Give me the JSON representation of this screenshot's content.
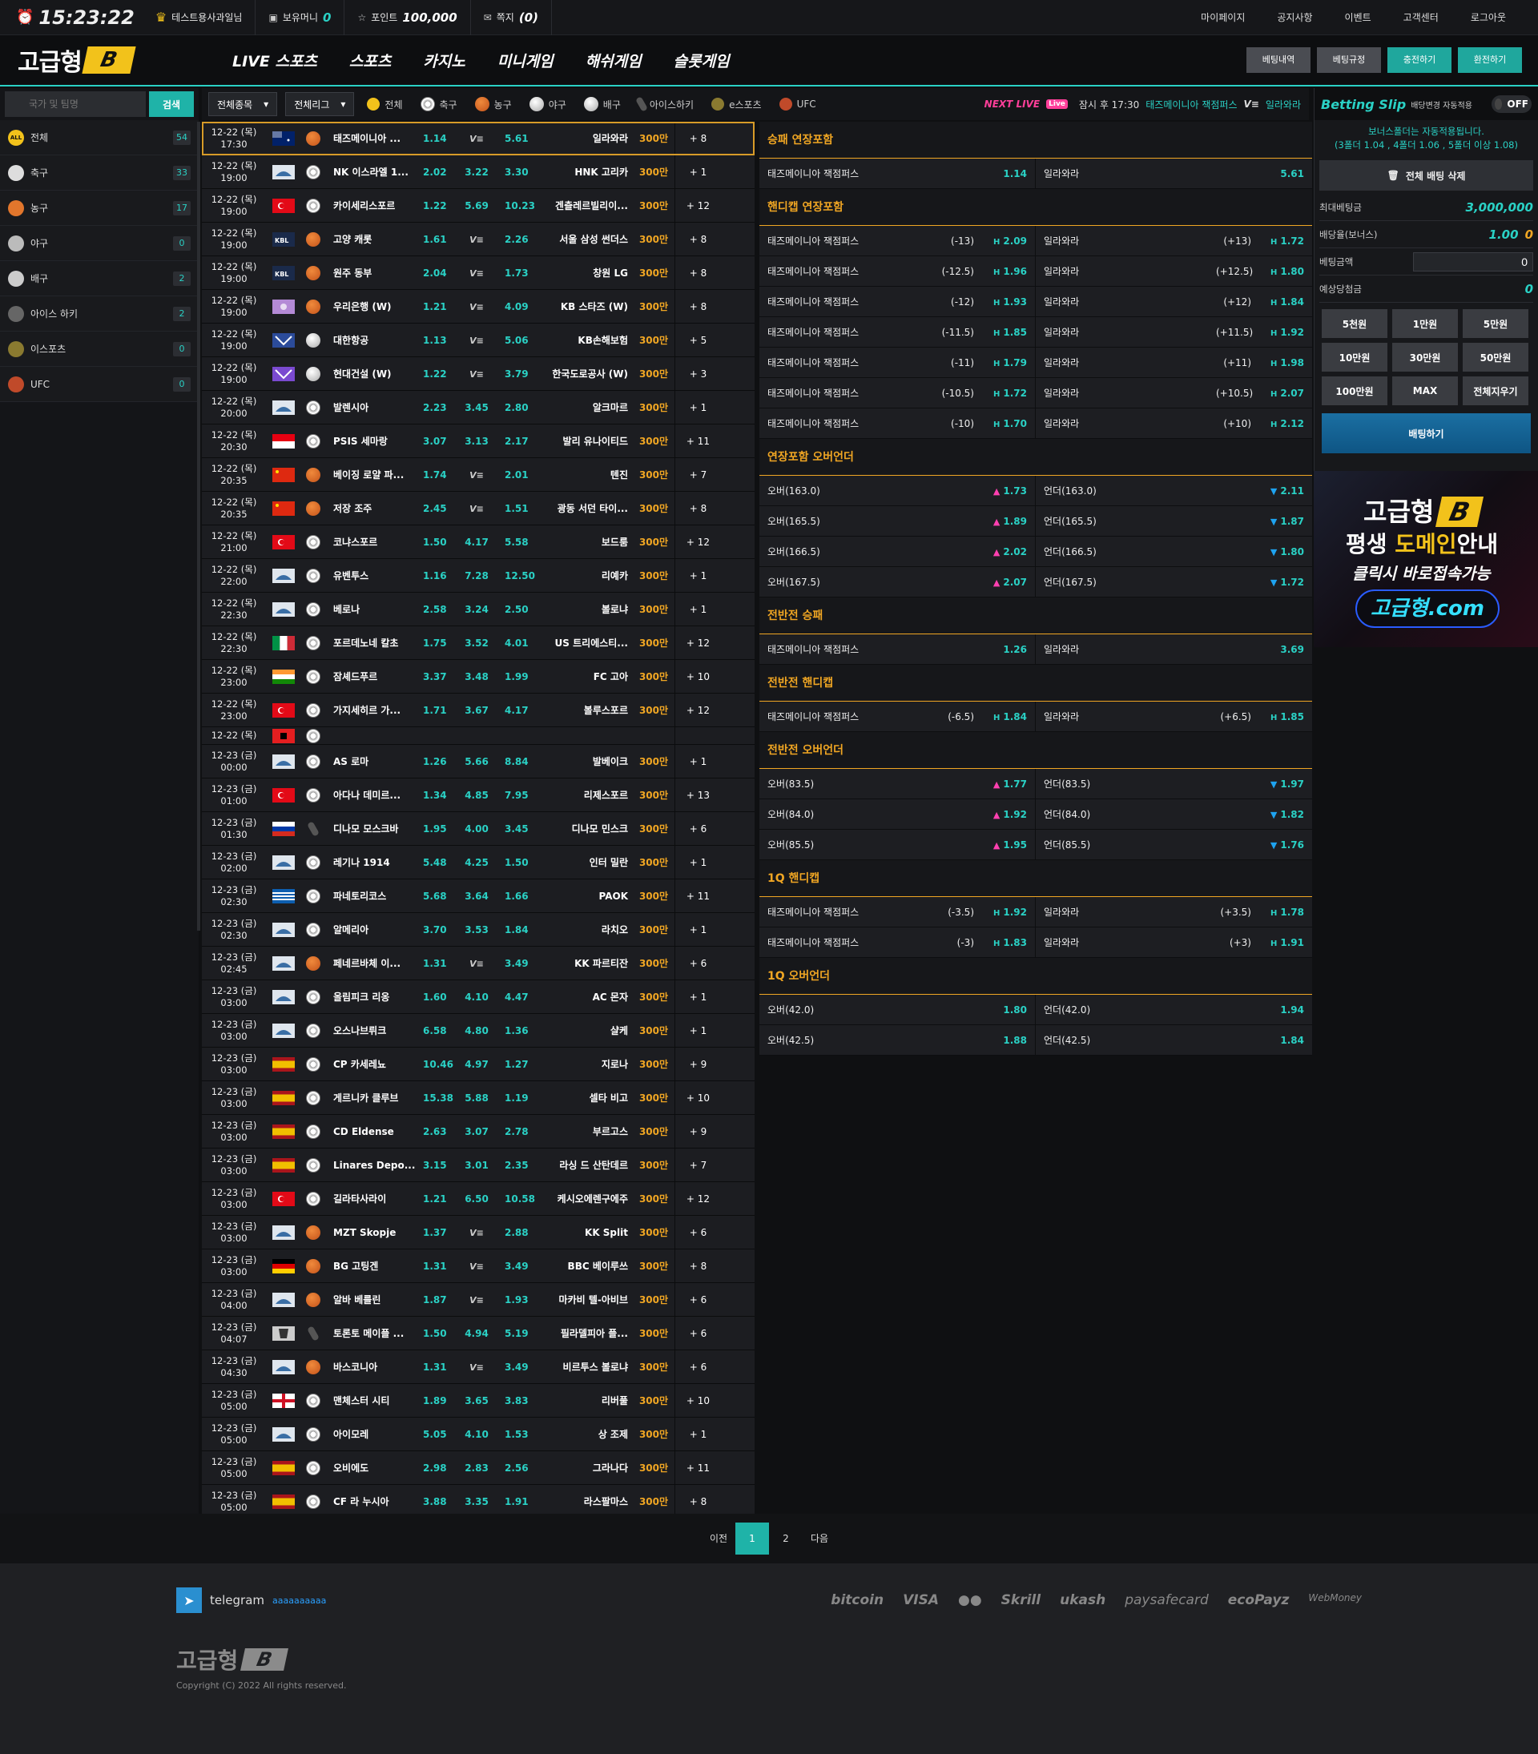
{
  "topbar": {
    "clock": "15:23:22",
    "user": "테스트용사과일님",
    "money_label": "보유머니",
    "money_value": "0",
    "point_label": "포인트",
    "point_value": "100,000",
    "msg_label": "쪽지",
    "msg_value": "(0)",
    "links": [
      "마이페이지",
      "공지사항",
      "이벤트",
      "고객센터",
      "로그아웃"
    ]
  },
  "header": {
    "logo_text": "고급형",
    "logo_badge": "B",
    "nav": [
      "LIVE 스포츠",
      "스포츠",
      "카지노",
      "미니게임",
      "해쉬게임",
      "슬롯게임"
    ],
    "buttons": [
      "베팅내역",
      "베팅규정",
      "충전하기",
      "환전하기"
    ]
  },
  "sidebar": {
    "search_placeholder": "국가 및 팀명",
    "search_button": "검색",
    "items": [
      {
        "label": "전체",
        "count": "54",
        "icon": "all-icon"
      },
      {
        "label": "축구",
        "count": "33",
        "icon": "soccer-icon"
      },
      {
        "label": "농구",
        "count": "17",
        "icon": "basketball-icon"
      },
      {
        "label": "야구",
        "count": "0",
        "icon": "baseball-icon"
      },
      {
        "label": "배구",
        "count": "2",
        "icon": "volleyball-icon"
      },
      {
        "label": "아이스 하키",
        "count": "2",
        "icon": "hockey-icon"
      },
      {
        "label": "이스포츠",
        "count": "0",
        "icon": "esports-icon"
      },
      {
        "label": "UFC",
        "count": "0",
        "icon": "ufc-icon"
      }
    ]
  },
  "filter": {
    "select1": "전체종목",
    "select2": "전체리그",
    "tabs": [
      "전체",
      "축구",
      "농구",
      "야구",
      "배구",
      "아이스하키",
      "e스포츠",
      "UFC"
    ],
    "next_live": "NEXT LIVE",
    "next_text": "잠시 후 17:30",
    "next_home": "태즈메이니아 잭점퍼스",
    "next_away": "일라와라"
  },
  "games": [
    {
      "date": "12-22 (목)",
      "time": "17:30",
      "flag": "au",
      "sport": "basket",
      "home": "태즈메이니아 ...",
      "o1": "1.14",
      "x": "VS",
      "o2": "5.61",
      "away": "일라와라",
      "lim": "300만",
      "more": "+ 8",
      "active": true
    },
    {
      "date": "12-22 (목)",
      "time": "19:00",
      "flag": "world",
      "sport": "soccer",
      "home": "NK 이스라엘 1...",
      "o1": "2.02",
      "x": "3.22",
      "o2": "3.30",
      "away": "HNK 고리카",
      "lim": "300만",
      "more": "+ 1"
    },
    {
      "date": "12-22 (목)",
      "time": "19:00",
      "flag": "tr",
      "sport": "soccer",
      "home": "카이세리스포르",
      "o1": "1.22",
      "x": "5.69",
      "o2": "10.23",
      "away": "겐츨레르빌리이...",
      "lim": "300만",
      "more": "+ 12"
    },
    {
      "date": "12-22 (목)",
      "time": "19:00",
      "flag": "kbl",
      "sport": "basket",
      "home": "고양 캐롯",
      "o1": "1.61",
      "x": "VS",
      "o2": "2.26",
      "away": "서울 삼성 썬더스",
      "lim": "300만",
      "more": "+ 8"
    },
    {
      "date": "12-22 (목)",
      "time": "19:00",
      "flag": "kbl",
      "sport": "basket",
      "home": "원주 동부",
      "o1": "2.04",
      "x": "VS",
      "o2": "1.73",
      "away": "창원 LG",
      "lim": "300만",
      "more": "+ 8"
    },
    {
      "date": "12-22 (목)",
      "time": "19:00",
      "flag": "wkbl",
      "sport": "basket",
      "home": "우리은행 (W)",
      "o1": "1.21",
      "x": "VS",
      "o2": "4.09",
      "away": "KB 스타즈 (W)",
      "lim": "300만",
      "more": "+ 8"
    },
    {
      "date": "12-22 (목)",
      "time": "19:00",
      "flag": "kovo",
      "sport": "volley",
      "home": "대한항공",
      "o1": "1.13",
      "x": "VS",
      "o2": "5.06",
      "away": "KB손해보험",
      "lim": "300만",
      "more": "+ 5"
    },
    {
      "date": "12-22 (목)",
      "time": "19:00",
      "flag": "kovow",
      "sport": "volley",
      "home": "현대건설 (W)",
      "o1": "1.22",
      "x": "VS",
      "o2": "3.79",
      "away": "한국도로공사 (W)",
      "lim": "300만",
      "more": "+ 3"
    },
    {
      "date": "12-22 (목)",
      "time": "20:00",
      "flag": "world",
      "sport": "soccer",
      "home": "발렌시아",
      "o1": "2.23",
      "x": "3.45",
      "o2": "2.80",
      "away": "알크마르",
      "lim": "300만",
      "more": "+ 1"
    },
    {
      "date": "12-22 (목)",
      "time": "20:30",
      "flag": "id",
      "sport": "soccer",
      "home": "PSIS 세마랑",
      "o1": "3.07",
      "x": "3.13",
      "o2": "2.17",
      "away": "발리 유나이티드",
      "lim": "300만",
      "more": "+ 11"
    },
    {
      "date": "12-22 (목)",
      "time": "20:35",
      "flag": "cn",
      "sport": "basket",
      "home": "베이징 로얄 파...",
      "o1": "1.74",
      "x": "VS",
      "o2": "2.01",
      "away": "텐진",
      "lim": "300만",
      "more": "+ 7"
    },
    {
      "date": "12-22 (목)",
      "time": "20:35",
      "flag": "cn",
      "sport": "basket",
      "home": "저장 조주",
      "o1": "2.45",
      "x": "VS",
      "o2": "1.51",
      "away": "광동 서던 타이...",
      "lim": "300만",
      "more": "+ 8"
    },
    {
      "date": "12-22 (목)",
      "time": "21:00",
      "flag": "tr",
      "sport": "soccer",
      "home": "코냐스포르",
      "o1": "1.50",
      "x": "4.17",
      "o2": "5.58",
      "away": "보드룸",
      "lim": "300만",
      "more": "+ 12"
    },
    {
      "date": "12-22 (목)",
      "time": "22:00",
      "flag": "world",
      "sport": "soccer",
      "home": "유벤투스",
      "o1": "1.16",
      "x": "7.28",
      "o2": "12.50",
      "away": "리예카",
      "lim": "300만",
      "more": "+ 1"
    },
    {
      "date": "12-22 (목)",
      "time": "22:30",
      "flag": "world",
      "sport": "soccer",
      "home": "베로나",
      "o1": "2.58",
      "x": "3.24",
      "o2": "2.50",
      "away": "볼로냐",
      "lim": "300만",
      "more": "+ 1"
    },
    {
      "date": "12-22 (목)",
      "time": "22:30",
      "flag": "it",
      "sport": "soccer",
      "home": "포르데노네 칼초",
      "o1": "1.75",
      "x": "3.52",
      "o2": "4.01",
      "away": "US 트리에스티...",
      "lim": "300만",
      "more": "+ 12"
    },
    {
      "date": "12-22 (목)",
      "time": "23:00",
      "flag": "in",
      "sport": "soccer",
      "home": "잠셰드푸르",
      "o1": "3.37",
      "x": "3.48",
      "o2": "1.99",
      "away": "FC 고아",
      "lim": "300만",
      "more": "+ 10"
    },
    {
      "date": "12-22 (목)",
      "time": "23:00",
      "flag": "tr",
      "sport": "soccer",
      "home": "가지세히르 가...",
      "o1": "1.71",
      "x": "3.67",
      "o2": "4.17",
      "away": "볼루스포르",
      "lim": "300만",
      "more": "+ 12"
    },
    {
      "date": "12-22 (목)",
      "time": "",
      "flag": "al",
      "sport": "soccer",
      "home": "",
      "o1": "",
      "x": "",
      "o2": "",
      "away": "",
      "lim": "",
      "more": "",
      "clip": true
    },
    {
      "date": "12-23 (금)",
      "time": "00:00",
      "flag": "world",
      "sport": "soccer",
      "home": "AS 로마",
      "o1": "1.26",
      "x": "5.66",
      "o2": "8.84",
      "away": "발베이크",
      "lim": "300만",
      "more": "+ 1"
    },
    {
      "date": "12-23 (금)",
      "time": "01:00",
      "flag": "tr",
      "sport": "soccer",
      "home": "아다나 데미르...",
      "o1": "1.34",
      "x": "4.85",
      "o2": "7.95",
      "away": "리제스포르",
      "lim": "300만",
      "more": "+ 13"
    },
    {
      "date": "12-23 (금)",
      "time": "01:30",
      "flag": "ru",
      "sport": "hockey",
      "home": "디나모 모스크바",
      "o1": "1.95",
      "x": "4.00",
      "o2": "3.45",
      "away": "디나모 민스크",
      "lim": "300만",
      "more": "+ 6"
    },
    {
      "date": "12-23 (금)",
      "time": "02:00",
      "flag": "world",
      "sport": "soccer",
      "home": "레기나 1914",
      "o1": "5.48",
      "x": "4.25",
      "o2": "1.50",
      "away": "인터 밀란",
      "lim": "300만",
      "more": "+ 1"
    },
    {
      "date": "12-23 (금)",
      "time": "02:30",
      "flag": "gr",
      "sport": "soccer",
      "home": "파네토리코스",
      "o1": "5.68",
      "x": "3.64",
      "o2": "1.66",
      "away": "PAOK",
      "lim": "300만",
      "more": "+ 11"
    },
    {
      "date": "12-23 (금)",
      "time": "02:30",
      "flag": "world",
      "sport": "soccer",
      "home": "알메리아",
      "o1": "3.70",
      "x": "3.53",
      "o2": "1.84",
      "away": "라치오",
      "lim": "300만",
      "more": "+ 1"
    },
    {
      "date": "12-23 (금)",
      "time": "02:45",
      "flag": "world",
      "sport": "basket",
      "home": "페네르바체 이...",
      "o1": "1.31",
      "x": "VS",
      "o2": "3.49",
      "away": "KK 파르티잔",
      "lim": "300만",
      "more": "+ 6"
    },
    {
      "date": "12-23 (금)",
      "time": "03:00",
      "flag": "world",
      "sport": "soccer",
      "home": "올림피크 리옹",
      "o1": "1.60",
      "x": "4.10",
      "o2": "4.47",
      "away": "AC 몬자",
      "lim": "300만",
      "more": "+ 1"
    },
    {
      "date": "12-23 (금)",
      "time": "03:00",
      "flag": "world",
      "sport": "soccer",
      "home": "오스나브뤼크",
      "o1": "6.58",
      "x": "4.80",
      "o2": "1.36",
      "away": "샬케",
      "lim": "300만",
      "more": "+ 1"
    },
    {
      "date": "12-23 (금)",
      "time": "03:00",
      "flag": "es",
      "sport": "soccer",
      "home": "CP 카세레뇨",
      "o1": "10.46",
      "x": "4.97",
      "o2": "1.27",
      "away": "지로나",
      "lim": "300만",
      "more": "+ 9"
    },
    {
      "date": "12-23 (금)",
      "time": "03:00",
      "flag": "es",
      "sport": "soccer",
      "home": "게르니카 클루브",
      "o1": "15.38",
      "x": "5.88",
      "o2": "1.19",
      "away": "셀타 비고",
      "lim": "300만",
      "more": "+ 10"
    },
    {
      "date": "12-23 (금)",
      "time": "03:00",
      "flag": "es",
      "sport": "soccer",
      "home": "CD Eldense",
      "o1": "2.63",
      "x": "3.07",
      "o2": "2.78",
      "away": "부르고스",
      "lim": "300만",
      "more": "+ 9"
    },
    {
      "date": "12-23 (금)",
      "time": "03:00",
      "flag": "es",
      "sport": "soccer",
      "home": "Linares Depo...",
      "o1": "3.15",
      "x": "3.01",
      "o2": "2.35",
      "away": "라싱 드 산탄데르",
      "lim": "300만",
      "more": "+ 7"
    },
    {
      "date": "12-23 (금)",
      "time": "03:00",
      "flag": "tr",
      "sport": "soccer",
      "home": "길라타사라이",
      "o1": "1.21",
      "x": "6.50",
      "o2": "10.58",
      "away": "케시오에렌구에주",
      "lim": "300만",
      "more": "+ 12"
    },
    {
      "date": "12-23 (금)",
      "time": "03:00",
      "flag": "world",
      "sport": "basket",
      "home": "MZT Skopje",
      "o1": "1.37",
      "x": "VS",
      "o2": "2.88",
      "away": "KK Split",
      "lim": "300만",
      "more": "+ 6"
    },
    {
      "date": "12-23 (금)",
      "time": "03:00",
      "flag": "de",
      "sport": "basket",
      "home": "BG 고팅겐",
      "o1": "1.31",
      "x": "VS",
      "o2": "3.49",
      "away": "BBC 베이루쓰",
      "lim": "300만",
      "more": "+ 8"
    },
    {
      "date": "12-23 (금)",
      "time": "04:00",
      "flag": "world",
      "sport": "basket",
      "home": "알바 베를린",
      "o1": "1.87",
      "x": "VS",
      "o2": "1.93",
      "away": "마카비 텔-아비브",
      "lim": "300만",
      "more": "+ 6"
    },
    {
      "date": "12-23 (금)",
      "time": "04:07",
      "flag": "nhl",
      "sport": "hockey",
      "home": "토론토 메이플 ...",
      "o1": "1.50",
      "x": "4.94",
      "o2": "5.19",
      "away": "필라델피아 플...",
      "lim": "300만",
      "more": "+ 6"
    },
    {
      "date": "12-23 (금)",
      "time": "04:30",
      "flag": "world",
      "sport": "basket",
      "home": "바스코니아",
      "o1": "1.31",
      "x": "VS",
      "o2": "3.49",
      "away": "비르투스 볼로냐",
      "lim": "300만",
      "more": "+ 6"
    },
    {
      "date": "12-23 (금)",
      "time": "05:00",
      "flag": "en",
      "sport": "soccer",
      "home": "맨체스터 시티",
      "o1": "1.89",
      "x": "3.65",
      "o2": "3.83",
      "away": "리버풀",
      "lim": "300만",
      "more": "+ 10"
    },
    {
      "date": "12-23 (금)",
      "time": "05:00",
      "flag": "world",
      "sport": "soccer",
      "home": "아이모레",
      "o1": "5.05",
      "x": "4.10",
      "o2": "1.53",
      "away": "상 조제",
      "lim": "300만",
      "more": "+ 1"
    },
    {
      "date": "12-23 (금)",
      "time": "05:00",
      "flag": "es",
      "sport": "soccer",
      "home": "오비에도",
      "o1": "2.98",
      "x": "2.83",
      "o2": "2.56",
      "away": "그라나다",
      "lim": "300만",
      "more": "+ 11"
    },
    {
      "date": "12-23 (금)",
      "time": "05:00",
      "flag": "es",
      "sport": "soccer",
      "home": "CF 라 누시아",
      "o1": "3.88",
      "x": "3.35",
      "o2": "1.91",
      "away": "라스팔마스",
      "lim": "300만",
      "more": "+ 8"
    }
  ],
  "markets": [
    {
      "title": "승패 연장포함",
      "rows": [
        {
          "h": "태즈메이니아 잭점퍼스",
          "hc": "",
          "ho": "1.14",
          "a": "일라와라",
          "ac": "",
          "ao": "5.61",
          "type": "plain"
        }
      ]
    },
    {
      "title": "핸디캡 연장포함",
      "rows": [
        {
          "h": "태즈메이니아 잭점퍼스",
          "hc": "(-13)",
          "ho": "2.09",
          "a": "일라와라",
          "ac": "(+13)",
          "ao": "1.72",
          "type": "h"
        },
        {
          "h": "태즈메이니아 잭점퍼스",
          "hc": "(-12.5)",
          "ho": "1.96",
          "a": "일라와라",
          "ac": "(+12.5)",
          "ao": "1.80",
          "type": "h"
        },
        {
          "h": "태즈메이니아 잭점퍼스",
          "hc": "(-12)",
          "ho": "1.93",
          "a": "일라와라",
          "ac": "(+12)",
          "ao": "1.84",
          "type": "h"
        },
        {
          "h": "태즈메이니아 잭점퍼스",
          "hc": "(-11.5)",
          "ho": "1.85",
          "a": "일라와라",
          "ac": "(+11.5)",
          "ao": "1.92",
          "type": "h"
        },
        {
          "h": "태즈메이니아 잭점퍼스",
          "hc": "(-11)",
          "ho": "1.79",
          "a": "일라와라",
          "ac": "(+11)",
          "ao": "1.98",
          "type": "h"
        },
        {
          "h": "태즈메이니아 잭점퍼스",
          "hc": "(-10.5)",
          "ho": "1.72",
          "a": "일라와라",
          "ac": "(+10.5)",
          "ao": "2.07",
          "type": "h"
        },
        {
          "h": "태즈메이니아 잭점퍼스",
          "hc": "(-10)",
          "ho": "1.70",
          "a": "일라와라",
          "ac": "(+10)",
          "ao": "2.12",
          "type": "h"
        }
      ]
    },
    {
      "title": "연장포함 오버언더",
      "rows": [
        {
          "h": "오버(163.0)",
          "hc": "",
          "ho": "1.73",
          "a": "언더(163.0)",
          "ac": "",
          "ao": "2.11",
          "type": "ou"
        },
        {
          "h": "오버(165.5)",
          "hc": "",
          "ho": "1.89",
          "a": "언더(165.5)",
          "ac": "",
          "ao": "1.87",
          "type": "ou"
        },
        {
          "h": "오버(166.5)",
          "hc": "",
          "ho": "2.02",
          "a": "언더(166.5)",
          "ac": "",
          "ao": "1.80",
          "type": "ou"
        },
        {
          "h": "오버(167.5)",
          "hc": "",
          "ho": "2.07",
          "a": "언더(167.5)",
          "ac": "",
          "ao": "1.72",
          "type": "ou"
        }
      ]
    },
    {
      "title": "전반전 승패",
      "rows": [
        {
          "h": "태즈메이니아 잭점퍼스",
          "hc": "",
          "ho": "1.26",
          "a": "일라와라",
          "ac": "",
          "ao": "3.69",
          "type": "plain"
        }
      ]
    },
    {
      "title": "전반전 핸디캡",
      "rows": [
        {
          "h": "태즈메이니아 잭점퍼스",
          "hc": "(-6.5)",
          "ho": "1.84",
          "a": "일라와라",
          "ac": "(+6.5)",
          "ao": "1.85",
          "type": "h"
        }
      ]
    },
    {
      "title": "전반전 오버언더",
      "rows": [
        {
          "h": "오버(83.5)",
          "hc": "",
          "ho": "1.77",
          "a": "언더(83.5)",
          "ac": "",
          "ao": "1.97",
          "type": "ou"
        },
        {
          "h": "오버(84.0)",
          "hc": "",
          "ho": "1.92",
          "a": "언더(84.0)",
          "ac": "",
          "ao": "1.82",
          "type": "ou"
        },
        {
          "h": "오버(85.5)",
          "hc": "",
          "ho": "1.95",
          "a": "언더(85.5)",
          "ac": "",
          "ao": "1.76",
          "type": "ou"
        }
      ]
    },
    {
      "title": "1Q 핸디캡",
      "rows": [
        {
          "h": "태즈메이니아 잭점퍼스",
          "hc": "(-3.5)",
          "ho": "1.92",
          "a": "일라와라",
          "ac": "(+3.5)",
          "ao": "1.78",
          "type": "h"
        },
        {
          "h": "태즈메이니아 잭점퍼스",
          "hc": "(-3)",
          "ho": "1.83",
          "a": "일라와라",
          "ac": "(+3)",
          "ao": "1.91",
          "type": "h"
        }
      ]
    },
    {
      "title": "1Q 오버언더",
      "rows": [
        {
          "h": "오버(42.0)",
          "hc": "",
          "ho": "1.80",
          "a": "언더(42.0)",
          "ac": "",
          "ao": "1.94",
          "type": "plain"
        },
        {
          "h": "오버(42.5)",
          "hc": "",
          "ho": "1.88",
          "a": "언더(42.5)",
          "ac": "",
          "ao": "1.84",
          "type": "plain"
        }
      ]
    }
  ],
  "slip": {
    "title": "Betting Slip",
    "subtitle": "배당변경 자동적용",
    "toggle": "OFF",
    "note1": "보너스폴더는 자동적용됩니다.",
    "note2": "(3폴더 1.04 , 4폴더 1.06 , 5폴더 이상 1.08)",
    "delete_all": "전체 배팅 삭제",
    "max_label": "최대베팅금",
    "max_value": "3,000,000",
    "odds_label": "배당율(보너스)",
    "odds_value": "1.00",
    "odds_bonus": "0",
    "amount_label": "베팅금액",
    "amount_value": "0",
    "expected_label": "예상당첨금",
    "expected_value": "0",
    "amounts": [
      "5천원",
      "1만원",
      "5만원",
      "10만원",
      "30만원",
      "50만원",
      "100만원",
      "MAX",
      "전체지우기"
    ],
    "bet_button": "배팅하기"
  },
  "banner": {
    "line1": "고급형",
    "badge": "B",
    "line2a": "평생 ",
    "line2b": "도메인",
    "line2c": "안내",
    "line3": "클릭시 바로접속가능",
    "line4": "고급형.com"
  },
  "pager": {
    "prev": "이전",
    "pages": [
      "1",
      "2"
    ],
    "next": "다음",
    "current": "1"
  },
  "footer": {
    "telegram": "telegram",
    "handle": "aaaaaaaaaa",
    "payments": [
      "bitcoin",
      "VISA",
      "●●",
      "Skrill",
      "ukash",
      "paysafecard",
      "ecoPayz",
      "WebMoney"
    ],
    "logo_text": "고급형",
    "logo_badge": "B",
    "copyright": "Copyright (C) 2022 All rights reserved."
  },
  "colors": {
    "accent": "#2ad1c5",
    "orange": "#f0a623",
    "brand_yellow": "#f2c21b"
  }
}
